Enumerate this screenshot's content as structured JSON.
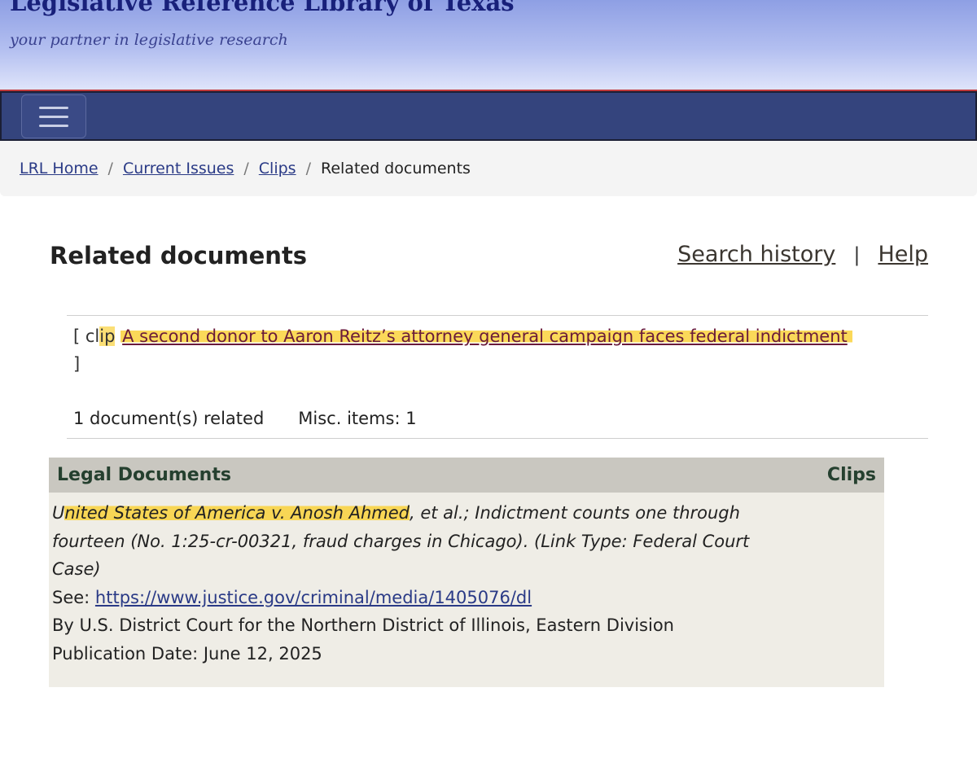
{
  "header": {
    "site_title": "Legislative Reference Library of Texas",
    "tagline": "your partner in legislative research"
  },
  "breadcrumb": {
    "items": [
      "LRL Home",
      "Current Issues",
      "Clips"
    ],
    "current": "Related documents",
    "separator": "/"
  },
  "page": {
    "title": "Related documents",
    "search_history": "Search history",
    "pipe": "|",
    "help": "Help"
  },
  "clip": {
    "open": "[ ",
    "type_label_prefix": "cl",
    "type_label_hl": "ip",
    "link_text": "A second donor to Aaron Reitz’s attorney general campaign faces federal indictment",
    "close": "]"
  },
  "counts": {
    "related": "1 document(s) related",
    "misc": "Misc. items: 1"
  },
  "legal_documents": {
    "heading": "Legal Documents",
    "clips_label": "Clips",
    "entry": {
      "case_first_letter": "U",
      "case_name_hl": "nited States of America v. Anosh Ahmed",
      "description_rest": ", et al.; Indictment counts one through fourteen (No. 1:25-cr-00321, fraud charges in Chicago). (Link Type: Federal Court Case)",
      "see_label": "See: ",
      "url": "https://www.justice.gov/criminal/media/1405076/dl",
      "by_line": "By U.S. District Court for the Northern District of Illinois, Eastern Division",
      "publication_date": "Publication Date: June 12, 2025"
    }
  },
  "colors": {
    "header_top": "#8e9fe4",
    "navbar": "#34447d",
    "highlight": "#fad23c",
    "table_head": "#c9c7c0",
    "table_body": "#efede6"
  }
}
